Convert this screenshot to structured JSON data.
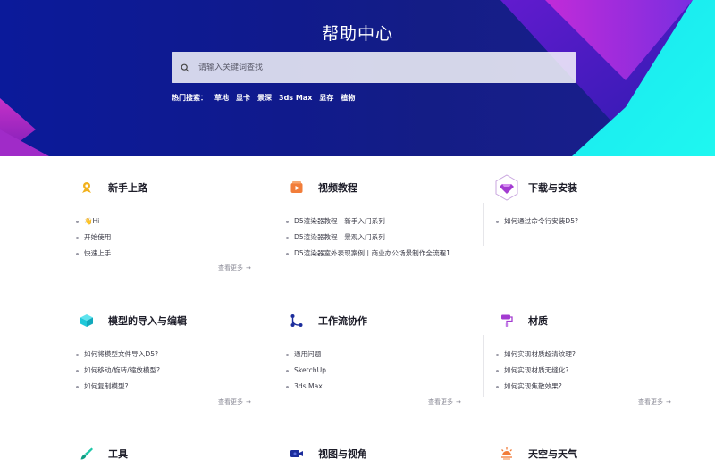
{
  "hero": {
    "title": "帮助中心",
    "search_placeholder": "请输入关键词查找",
    "hot_label": "热门搜索：",
    "hot_terms": [
      "草地",
      "显卡",
      "景深",
      "3ds Max",
      "显存",
      "植物"
    ]
  },
  "categories": [
    {
      "title": "新手上路",
      "icon": "rocket-icon",
      "color": "#f2b11c",
      "items": [
        "👋Hi",
        "开始使用",
        "快速上手"
      ],
      "more": "查看更多"
    },
    {
      "title": "视频教程",
      "icon": "video-icon",
      "color": "#f27d3a",
      "items": [
        "D5渲染器教程丨新手入门系列",
        "D5渲染器教程丨景观入门系列",
        "D5渲染器室外表现案例丨商业办公场景制作全流程1…"
      ],
      "more": ""
    },
    {
      "title": "下载与安装",
      "icon": "diamond-icon",
      "color": "#a33bd1",
      "items": [
        "如何通过命令行安装D5?"
      ],
      "more": ""
    },
    {
      "title": "模型的导入与编辑",
      "icon": "cube-icon",
      "color": "#1fc8d9",
      "items": [
        "如何将模型文件导入D5?",
        "如何移动/旋转/缩放模型?",
        "如何复制模型?"
      ],
      "more": "查看更多"
    },
    {
      "title": "工作流协作",
      "icon": "workflow-icon",
      "color": "#1c2d9c",
      "items": [
        "通用问题",
        "SketchUp",
        "3ds Max"
      ],
      "more": "查看更多"
    },
    {
      "title": "材质",
      "icon": "paint-roller-icon",
      "color": "#a33bd1",
      "items": [
        "如何实现材质超清纹理?",
        "如何实现材质无缝化?",
        "如何实现焦散效果?"
      ],
      "more": "查看更多"
    },
    {
      "title": "工具",
      "icon": "brush-icon",
      "color": "#1fc8a9",
      "items": [],
      "more": ""
    },
    {
      "title": "视图与视角",
      "icon": "camera-icon",
      "color": "#1c2d9c",
      "items": [],
      "more": ""
    },
    {
      "title": "天空与天气",
      "icon": "sun-icon",
      "color": "#f27d3a",
      "items": [],
      "more": ""
    }
  ]
}
